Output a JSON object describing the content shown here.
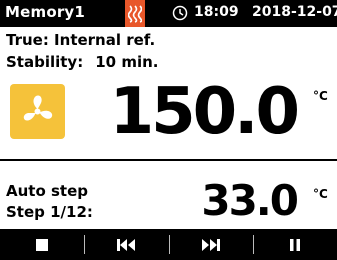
{
  "header": {
    "title": "Memory1",
    "heater_icon": "heater-icon",
    "clock_icon": "clock-icon",
    "time": "18:09",
    "date": "2018-12-07"
  },
  "info": {
    "control_line": "True: Internal ref.",
    "stability_label": "Stability:",
    "stability_value": "10 min."
  },
  "main": {
    "fan_icon": "fan-icon",
    "temperature": "150.0",
    "unit": "°C"
  },
  "program": {
    "mode_label": "Auto step",
    "step_label": "Step 1/12:",
    "step_temperature": "33.0",
    "unit": "°C"
  },
  "toolbar": {
    "buttons": [
      {
        "name": "stop",
        "icon": "stop-icon"
      },
      {
        "name": "previous",
        "icon": "skip-previous-icon"
      },
      {
        "name": "next",
        "icon": "skip-next-icon"
      },
      {
        "name": "pause",
        "icon": "pause-icon"
      }
    ]
  },
  "colors": {
    "header_bg": "#000000",
    "heater_accent": "#e8572a",
    "fan_tile": "#f5c23a",
    "background": "#ffffff"
  }
}
